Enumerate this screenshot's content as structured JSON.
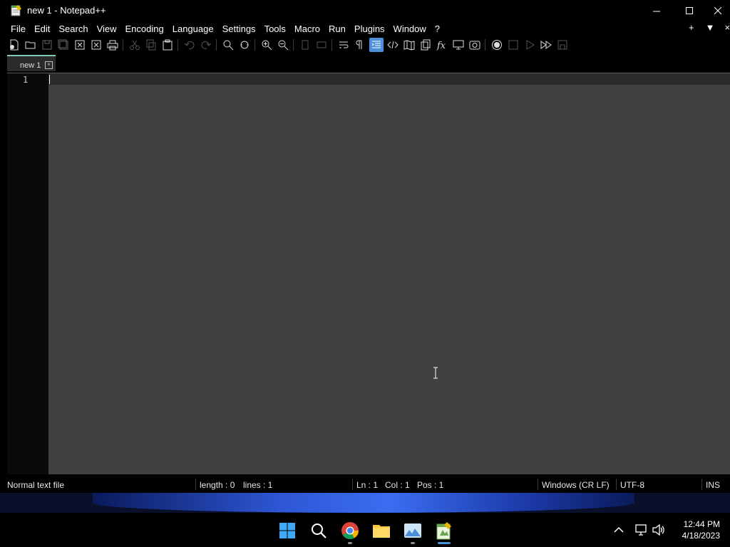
{
  "window": {
    "title": "new 1 - Notepad++"
  },
  "menu": {
    "items": [
      "File",
      "Edit",
      "Search",
      "View",
      "Encoding",
      "Language",
      "Settings",
      "Tools",
      "Macro",
      "Run",
      "Plugins",
      "Window",
      "?"
    ],
    "right": [
      "+",
      "▼",
      "×"
    ]
  },
  "tabs": [
    {
      "label": "new 1"
    }
  ],
  "editor": {
    "line_number": "1"
  },
  "status": {
    "file_type": "Normal text file",
    "length": "length : 0",
    "lines": "lines : 1",
    "ln": "Ln : 1",
    "col": "Col : 1",
    "pos": "Pos : 1",
    "eol": "Windows (CR LF)",
    "encoding": "UTF-8",
    "mode": "INS"
  },
  "taskbar": {
    "apps": [
      "windows-start-icon",
      "search-icon",
      "chrome-icon",
      "file-explorer-icon",
      "photos-icon",
      "notepadpp-icon"
    ],
    "time": "12:44 PM",
    "date": "4/18/2023"
  },
  "colors": {
    "accent": "#4d8fd8",
    "tab_accent": "#7fc7b8",
    "editor_bg": "#404040"
  }
}
